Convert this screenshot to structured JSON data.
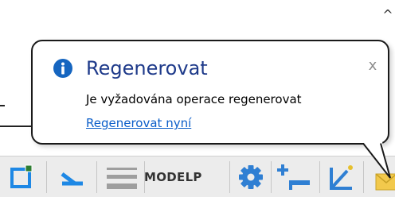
{
  "balloon": {
    "title": "Regenerovat",
    "message": "Je vyžadována operace regenerovat",
    "link": "Regenerovat nyní",
    "close_symbol": "x",
    "icon": "info-icon",
    "title_color": "#1e3a8a",
    "link_color": "#0b5ec9",
    "icon_color": "#1565c0"
  },
  "scrollbar": {
    "up_arrow": "^"
  },
  "status_bar": {
    "modelp_label": "MODELP",
    "items": [
      {
        "icon": "snap-square-icon",
        "accent": "#1e88e5"
      },
      {
        "icon": "polar-tracking-icon",
        "accent": "#1e88e5"
      },
      {
        "icon": "lineweight-icon",
        "accent": "#9e9e9e"
      },
      {
        "icon": "model-paper-toggle",
        "accent": "#333333"
      },
      {
        "icon": "gear-icon",
        "accent": "#2f7fd3"
      },
      {
        "icon": "add-scale-icon",
        "accent": "#2f7fd3"
      },
      {
        "icon": "ucs-icon",
        "accent": "#2f7fd3"
      },
      {
        "icon": "notification-icon",
        "accent": "#f2c94c"
      }
    ]
  }
}
